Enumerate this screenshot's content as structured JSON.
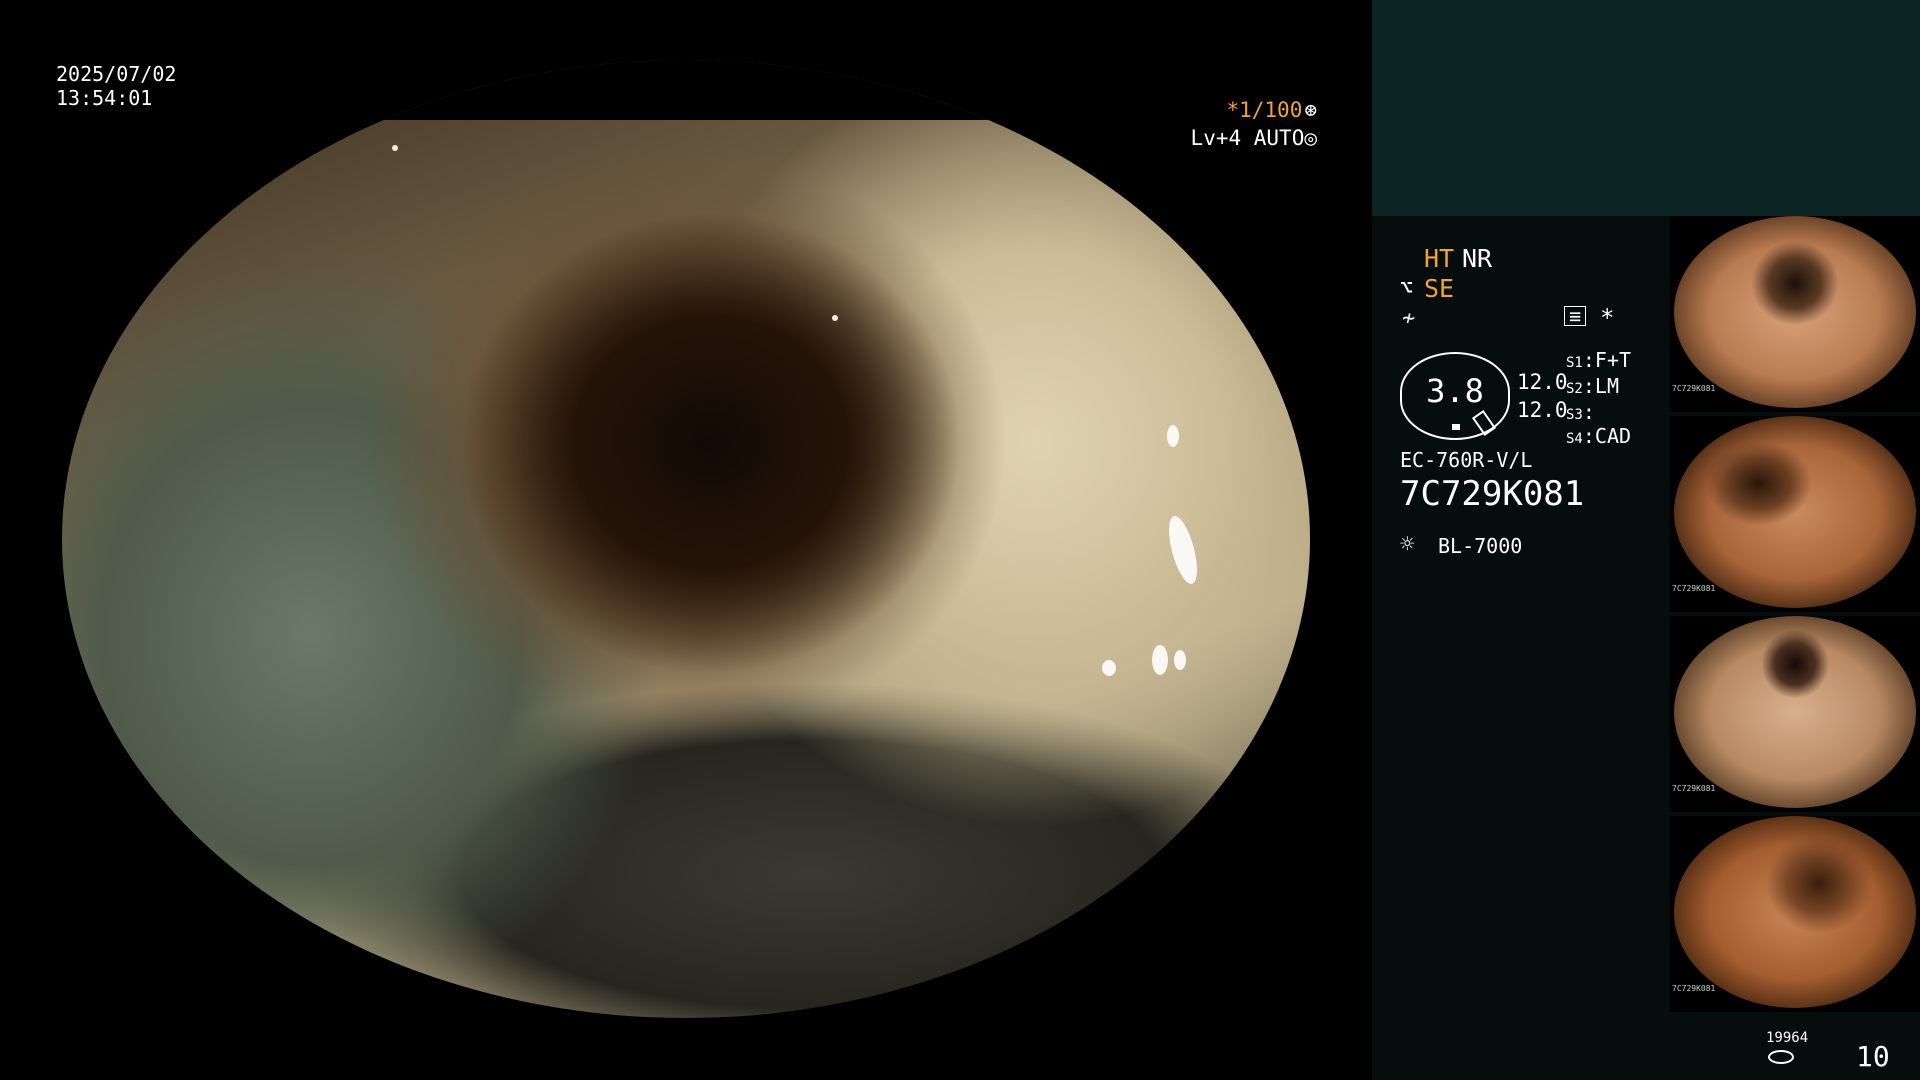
{
  "overlay": {
    "date": "2025/07/02",
    "time": "13:54:01",
    "shutter": "*1/100",
    "iris": "Lv+4 AUTO"
  },
  "panel": {
    "ht": "HT",
    "nr": "NR",
    "se": "SE",
    "badge_value": "3.8",
    "value1": "12.0",
    "value2": "12.0",
    "s1": {
      "key": "S1",
      "value": "F+T"
    },
    "s2": {
      "key": "S2",
      "value": "LM"
    },
    "s3": {
      "key": "S3",
      "value": ""
    },
    "s4": {
      "key": "S4",
      "value": "CAD"
    },
    "scope_model": "EC-760R-V/L",
    "scope_serial": "7C729K081",
    "light_source": "BL-7000",
    "image_count_small": "19964",
    "image_count_big": "10"
  },
  "thumbnails": [
    {
      "label": "7C729K081"
    },
    {
      "label": "7C729K081"
    },
    {
      "label": "7C729K081"
    },
    {
      "label": "7C729K081"
    }
  ],
  "colors": {
    "accent_orange": "#f2a23a",
    "panel_bg": "#060d0d",
    "panel_top": "#0c2423"
  }
}
